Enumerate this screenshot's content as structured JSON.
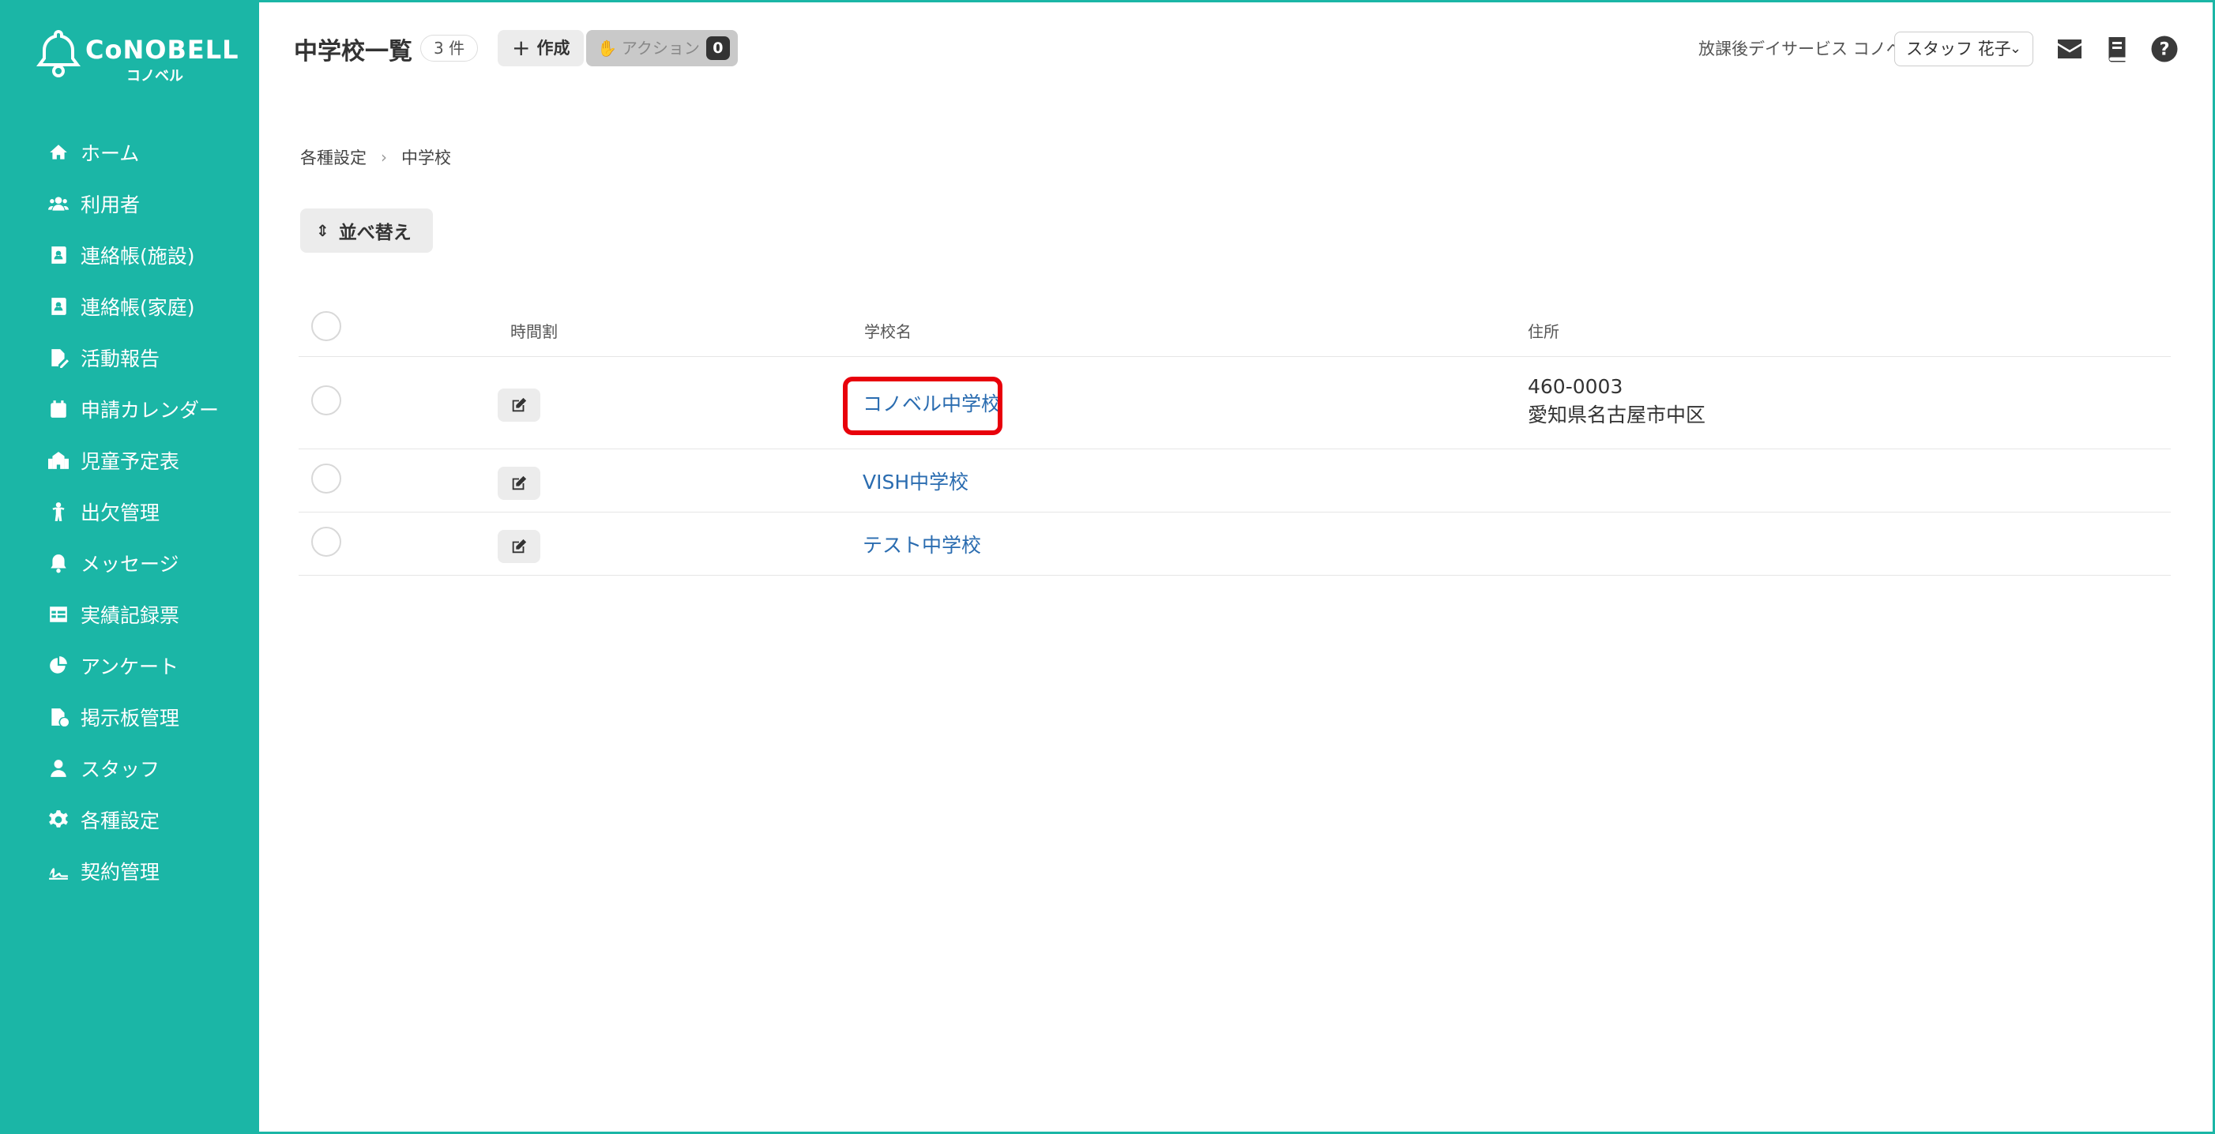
{
  "sidebar": {
    "brand": "CoNOBELL",
    "brand_sub": "コノベル",
    "items": [
      {
        "label": "ホーム",
        "icon": "home-icon"
      },
      {
        "label": "利用者",
        "icon": "users-icon"
      },
      {
        "label": "連絡帳(施設)",
        "icon": "contact-book-icon"
      },
      {
        "label": "連絡帳(家庭)",
        "icon": "contact-book-icon"
      },
      {
        "label": "活動報告",
        "icon": "file-pen-icon"
      },
      {
        "label": "申請カレンダー",
        "icon": "calendar-icon"
      },
      {
        "label": "児童予定表",
        "icon": "school-building-icon"
      },
      {
        "label": "出欠管理",
        "icon": "child-icon"
      },
      {
        "label": "メッセージ",
        "icon": "bell-icon"
      },
      {
        "label": "実績記録票",
        "icon": "table-icon"
      },
      {
        "label": "アンケート",
        "icon": "pie-chart-icon"
      },
      {
        "label": "掲示板管理",
        "icon": "file-check-icon"
      },
      {
        "label": "スタッフ",
        "icon": "staff-icon"
      },
      {
        "label": "各種設定",
        "icon": "gear-icon"
      },
      {
        "label": "契約管理",
        "icon": "signature-icon"
      }
    ]
  },
  "header": {
    "title": "中学校一覧",
    "count": "3 件",
    "create_label": "作成",
    "action_label": "アクション",
    "action_count": "0",
    "facility": "放課後デイサービス コノベル",
    "staff_selected": "スタッフ 花子"
  },
  "breadcrumb": [
    "各種設定",
    "中学校"
  ],
  "sort_label": "並べ替え",
  "table": {
    "columns": [
      "時間割",
      "学校名",
      "住所"
    ],
    "rows": [
      {
        "name": "コノベル中学校",
        "postal": "460-0003",
        "address": "愛知県名古屋市中区",
        "highlighted": true
      },
      {
        "name": "VISH中学校",
        "postal": "",
        "address": "",
        "highlighted": false
      },
      {
        "name": "テスト中学校",
        "postal": "",
        "address": "",
        "highlighted": false
      }
    ]
  },
  "colors": {
    "sidebar": "#1bb6a6",
    "link": "#2a6cb0",
    "highlight": "#e8000b"
  }
}
